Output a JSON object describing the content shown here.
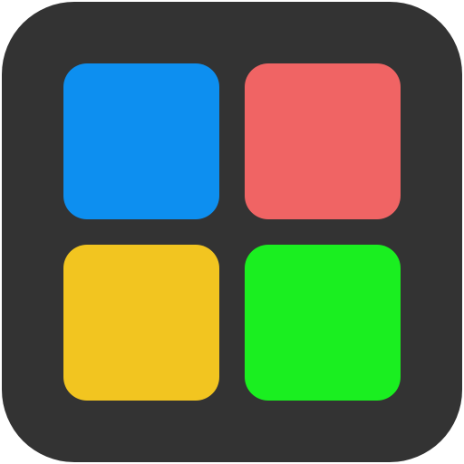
{
  "icon": {
    "background_color": "#333333",
    "tiles": [
      {
        "name": "blue-tile",
        "color": "#0d8ff0"
      },
      {
        "name": "red-tile",
        "color": "#f06464"
      },
      {
        "name": "yellow-tile",
        "color": "#f2c520"
      },
      {
        "name": "green-tile",
        "color": "#1aef20"
      }
    ]
  }
}
